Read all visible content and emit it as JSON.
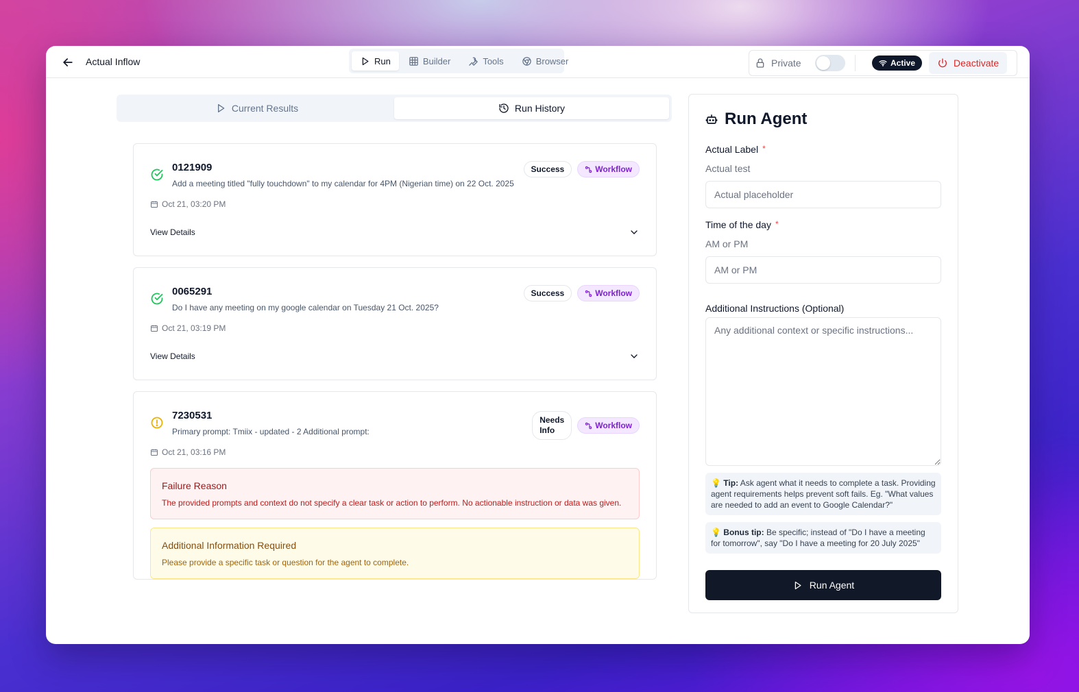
{
  "header": {
    "title": "Actual Inflow",
    "tabs": [
      {
        "label": "Run",
        "icon": "play-icon",
        "active": true
      },
      {
        "label": "Builder",
        "icon": "grid-icon",
        "active": false
      },
      {
        "label": "Tools",
        "icon": "wrench-icon",
        "active": false
      },
      {
        "label": "Browser",
        "icon": "chrome-icon",
        "active": false
      }
    ],
    "private_label": "Private",
    "private_on": false,
    "status_badge": "Active",
    "deactivate_label": "Deactivate"
  },
  "results_tabs": {
    "current": "Current Results",
    "history": "Run History",
    "active": "history"
  },
  "runs": [
    {
      "id": "0121909",
      "status": "success",
      "prompt": "Add a meeting titled \"fully touchdown\" to my calendar for 4PM (Nigerian time) on 22 Oct. 2025",
      "date": "Oct 21, 03:20 PM",
      "status_badge": "Success",
      "type_badge": "Workflow",
      "details_label": "View Details"
    },
    {
      "id": "0065291",
      "status": "success",
      "prompt": "Do I have any meeting on my google calendar on Tuesday 21 Oct. 2025?",
      "date": "Oct 21, 03:19 PM",
      "status_badge": "Success",
      "type_badge": "Workflow",
      "details_label": "View Details"
    },
    {
      "id": "7230531",
      "status": "needs-info",
      "prompt": "Primary prompt: Tmiix - updated - 2 Additional prompt:",
      "date": "Oct 21, 03:16 PM",
      "status_badge_line1": "Needs",
      "status_badge_line2": "Info",
      "type_badge": "Workflow",
      "failure_title": "Failure Reason",
      "failure_text": "The provided prompts and context do not specify a clear task or action to perform. No actionable instruction or data was given.",
      "info_title": "Additional Information Required",
      "info_text": "Please provide a specific task or question for the agent to complete."
    }
  ],
  "panel": {
    "title": "Run Agent",
    "fields": [
      {
        "label": "Actual Label",
        "required_mark": "*",
        "description": "Actual test",
        "placeholder": "Actual placeholder",
        "value": ""
      },
      {
        "label": "Time of the day",
        "required_mark": "*",
        "description": "AM or PM",
        "placeholder": "AM or PM",
        "value": ""
      }
    ],
    "instructions_label": "Additional Instructions (Optional)",
    "instructions_placeholder": "Any additional context or specific instructions...",
    "tip_label": "Tip:",
    "tip_text": "Ask agent what it needs to complete a task. Providing agent requirements helps prevent soft fails. Eg. \"What values are needed to add an event to Google Calendar?\"",
    "bonus_label": "Bonus tip:",
    "bonus_text": "Be specific; instead of \"Do I have a meeting for tomorrow\", say \"Do I have a meeting for 20 July 2025\"",
    "tip_emoji": "💡",
    "run_button": "Run Agent"
  },
  "colors": {
    "success": "#22c55e",
    "warning": "#eab308",
    "danger": "#dc2626",
    "workflow": "#7e22ce",
    "primary": "#111827"
  }
}
